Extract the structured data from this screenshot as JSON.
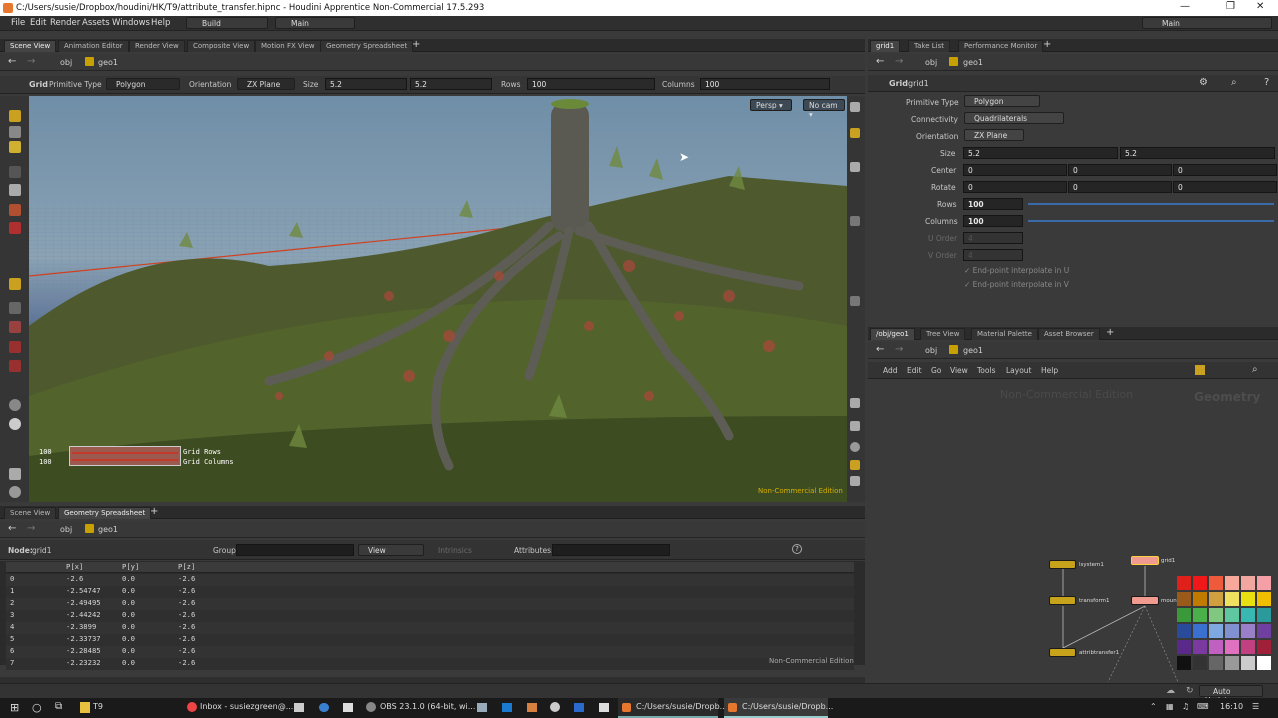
{
  "window": {
    "title": "C:/Users/susie/Dropbox/houdini/HK/T9/attribute_transfer.hipnc - Houdini Apprentice Non-Commercial 17.5.293"
  },
  "menu": {
    "items": [
      "File",
      "Edit",
      "Render",
      "Assets",
      "Windows",
      "Help"
    ],
    "desktop": "Build",
    "main": "Main",
    "right_main": "Main"
  },
  "left_tabs": [
    "Scene View",
    "Animation Editor",
    "Render View",
    "Composite View",
    "Motion FX View",
    "Geometry Spreadsheet"
  ],
  "right_top_tabs": [
    "grid1",
    "Take List",
    "Performance Monitor"
  ],
  "right_bottom_tabs": [
    "/obj/geo1",
    "Tree View",
    "Material Palette",
    "Asset Browser"
  ],
  "bottom_tabs": [
    "Scene View",
    "Geometry Spreadsheet"
  ],
  "path": {
    "obj": "obj",
    "geo": "geo1"
  },
  "toolbar": {
    "node": "Grid",
    "ptype_label": "Primitive Type",
    "ptype": "Polygon",
    "orient_label": "Orientation",
    "orient": "ZX Plane",
    "size_label": "Size",
    "size1": "5.2",
    "size2": "5.2",
    "rows_label": "Rows",
    "rows": "100",
    "cols_label": "Columns",
    "cols": "100"
  },
  "viewport": {
    "persp": "Persp",
    "cam": "No cam",
    "watermark": "Non-Commercial Edition",
    "hud_val1": "100",
    "hud_val2": "100",
    "hud_lbl1": "Grid Rows",
    "hud_lbl2": "Grid Columns"
  },
  "params": {
    "node_type": "Grid",
    "node_name": "grid1",
    "primitive_type_label": "Primitive Type",
    "primitive_type": "Polygon",
    "connectivity_label": "Connectivity",
    "connectivity": "Quadrilaterals",
    "orientation_label": "Orientation",
    "orientation": "ZX Plane",
    "size_label": "Size",
    "size": [
      "5.2",
      "5.2"
    ],
    "center_label": "Center",
    "center": [
      "0",
      "0",
      "0"
    ],
    "rotate_label": "Rotate",
    "rotate": [
      "0",
      "0",
      "0"
    ],
    "rows_label": "Rows",
    "rows": "100",
    "columns_label": "Columns",
    "columns": "100",
    "uorder_label": "U Order",
    "uorder": "4",
    "vorder_label": "V Order",
    "vorder": "4",
    "endu": "End-point interpolate in U",
    "endv": "End-point interpolate in V"
  },
  "network": {
    "menu": [
      "Add",
      "Edit",
      "Go",
      "View",
      "Tools",
      "Layout",
      "Help"
    ],
    "watermark": "Non-Commercial Edition",
    "context": "Geometry",
    "nodes": [
      "lsystem1",
      "transform1",
      "attribtransfer1",
      "grid1",
      "mountain1"
    ]
  },
  "sheet": {
    "node_label": "Node:",
    "node": "grid1",
    "group_label": "Group:",
    "view": "View",
    "intrinsics": "Intrinsics",
    "attributes_label": "Attributes:",
    "headers": [
      "",
      "P[x]",
      "P[y]",
      "P[z]"
    ],
    "rows": [
      [
        "0",
        "-2.6",
        "0.0",
        "-2.6"
      ],
      [
        "1",
        "-2.54747",
        "0.0",
        "-2.6"
      ],
      [
        "2",
        "-2.49495",
        "0.0",
        "-2.6"
      ],
      [
        "3",
        "-2.44242",
        "0.0",
        "-2.6"
      ],
      [
        "4",
        "-2.3899",
        "0.0",
        "-2.6"
      ],
      [
        "5",
        "-2.33737",
        "0.0",
        "-2.6"
      ],
      [
        "6",
        "-2.28485",
        "0.0",
        "-2.6"
      ],
      [
        "7",
        "-2.23232",
        "0.0",
        "-2.6"
      ]
    ],
    "watermark": "Non-Commercial Edition"
  },
  "status": {
    "auto_update": "Auto Update"
  },
  "palette_colors": [
    "#e0201a",
    "#f01818",
    "#f05a3c",
    "#f7a89a",
    "#f2a6a0",
    "#f5a0a6",
    "#9a5a1a",
    "#c07a00",
    "#d0a040",
    "#f0e060",
    "#e8e010",
    "#f0c000",
    "#3a9a3a",
    "#4ab04a",
    "#80c880",
    "#60c8a0",
    "#38b8b0",
    "#2a9a9a",
    "#2a4a9a",
    "#3a70d0",
    "#80a8e0",
    "#8090d0",
    "#9a80c8",
    "#7040a0",
    "#5a2a8a",
    "#7a3aa0",
    "#c060c0",
    "#e070c0",
    "#c04080",
    "#a0203a",
    "#111111",
    "#333333",
    "#666666",
    "#999999",
    "#cccccc",
    "#ffffff"
  ],
  "taskbar": {
    "items": [
      "T9",
      "Inbox - susiezgreen@...",
      "OBS 23.1.0 (64-bit, wi...",
      "C:/Users/susie/Dropb...",
      "C:/Users/susie/Dropb..."
    ],
    "time": "16:10"
  }
}
